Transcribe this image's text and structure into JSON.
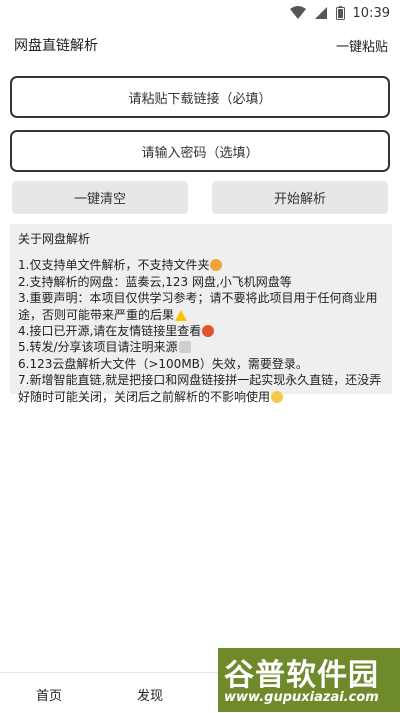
{
  "status_bar": {
    "time": "10:39"
  },
  "app_bar": {
    "title": "网盘直链解析",
    "paste_label": "一键粘贴"
  },
  "inputs": {
    "url_placeholder": "请粘贴下载链接（必填）",
    "password_placeholder": "请输入密码（选填）"
  },
  "actions": {
    "clear_label": "一键清空",
    "parse_label": "开始解析"
  },
  "about": {
    "title": "关于网盘解析",
    "lines": [
      {
        "text": "1.仅支持单文件解析，不支持文件夹",
        "emoji": "cat-icon"
      },
      {
        "text": "2.支持解析的网盘：蓝奏云,123 网盘,小飞机网盘等",
        "emoji": ""
      },
      {
        "text": "3.重要声明：本项目仅供学习参考；请不要将此项目用于任何商业用途，否则可能带来严重的后果",
        "emoji": "warning-icon"
      },
      {
        "text": "4.接口已开源,请在友情链接里查看",
        "emoji": "crab-icon"
      },
      {
        "text": "5.转发/分享该项目请注明来源",
        "emoji": "document-icon"
      },
      {
        "text": "6.123云盘解析大文件（>100MB）失效，需要登录。",
        "emoji": ""
      },
      {
        "text": "7.新增智能直链,就是把接口和网盘链接拼一起实现永久直链，还没弄好随时可能关闭，关闭后之前解析的不影响使用",
        "emoji": "smile-icon"
      }
    ]
  },
  "bottom_nav": {
    "home_label": "首页",
    "discover_label": "发现"
  },
  "watermark": {
    "brand": "谷普软件园",
    "url": "www.gupuxiazai.com"
  },
  "colors": {
    "input_border": "#2f3440",
    "button_bg": "#e7e7e7",
    "card_bg": "#efefef",
    "watermark_bg": "#6f8a2a"
  }
}
